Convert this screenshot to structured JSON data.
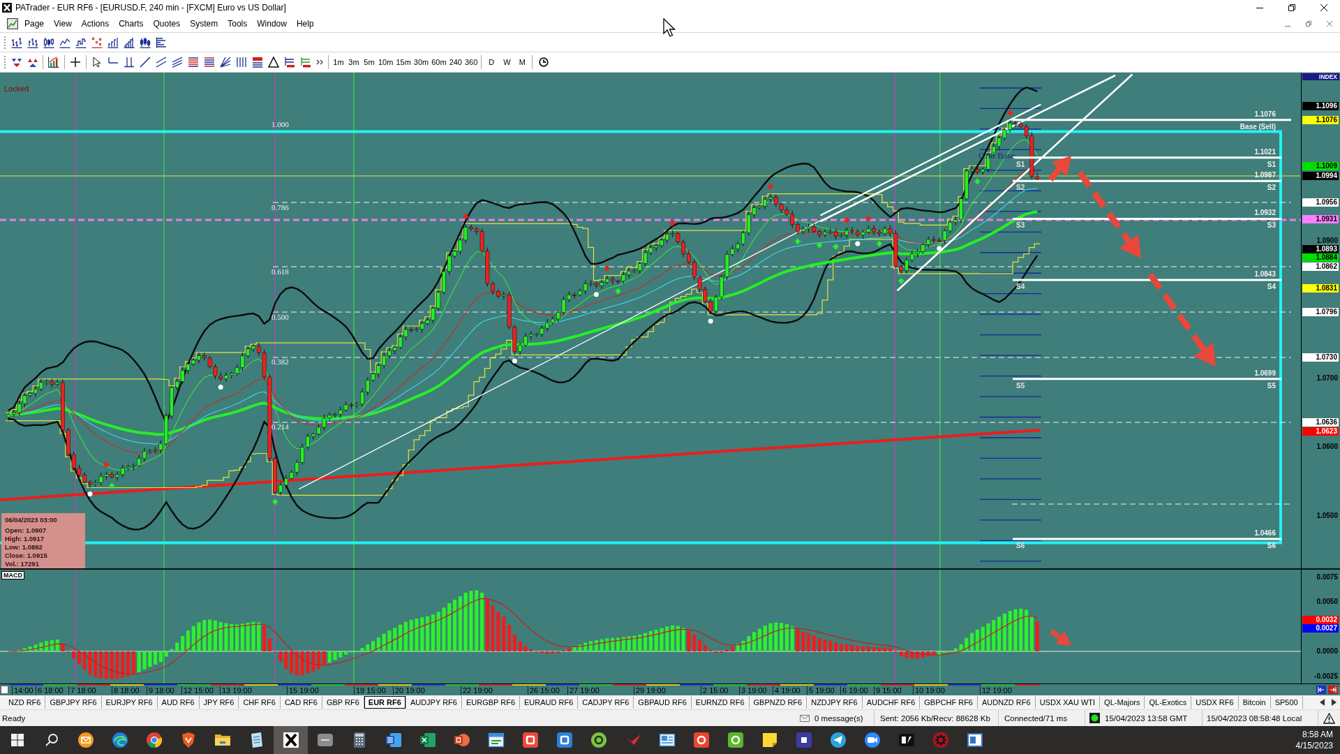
{
  "window": {
    "title": "PATrader - EUR RF6 - [EURUSD.F, 240 min - [FXCM] Euro vs US Dollar]"
  },
  "menu": [
    "Page",
    "View",
    "Actions",
    "Charts",
    "Quotes",
    "System",
    "Tools",
    "Window",
    "Help"
  ],
  "timeframes": [
    "1m",
    "3m",
    "5m",
    "10m",
    "15m",
    "30m",
    "60m",
    "240",
    "360"
  ],
  "periods": [
    "D",
    "W",
    "M"
  ],
  "chart": {
    "status": "Locked",
    "fib_levels": [
      "1.000",
      "0.786",
      "0.618",
      "0.500",
      "0.382",
      "0.214"
    ],
    "grid_label": "Grid Base",
    "pivots": [
      {
        "price": "1.1076",
        "label": "Base (Sell)"
      },
      {
        "price": "1.1021",
        "label": "S1",
        "start_label": "S1"
      },
      {
        "price": "1.0987",
        "label": "S2",
        "start_label": "S2"
      },
      {
        "price": "1.0932",
        "label": "S3",
        "start_label": "S3"
      },
      {
        "price": "1.0843",
        "label": "S4",
        "start_label": "S4"
      },
      {
        "price": "1.0699",
        "label": "S5",
        "start_label": "S5"
      },
      {
        "price": "1.0466",
        "label": "S6",
        "start_label": "S6"
      }
    ],
    "info": {
      "time": "06/04/2023 03:00",
      "lines": [
        "Open: 1.0907",
        "High: 1.0917",
        "Low: 1.0892",
        "Close: 1.0915",
        "Vol.: 17291"
      ]
    },
    "price_axis": {
      "header": "INDEX",
      "ticks": [
        "1.0900",
        "1.0700",
        "1.0600",
        "1.0500"
      ],
      "tags": [
        {
          "value": "1.1096",
          "color": "#000000"
        },
        {
          "value": "1.1076",
          "color": "#ffff00"
        },
        {
          "value": "1.1009",
          "color": "#00e000"
        },
        {
          "value": "1.0994",
          "color": "#000000"
        },
        {
          "value": "1.0956",
          "color": "#ffffff"
        },
        {
          "value": "1.0931",
          "color": "#ff80ff"
        },
        {
          "value": "1.0893",
          "color": "#000000"
        },
        {
          "value": "1.0884",
          "color": "#00e000"
        },
        {
          "value": "1.0862",
          "color": "#ffffff"
        },
        {
          "value": "1.0831",
          "color": "#ffff00"
        },
        {
          "value": "1.0796",
          "color": "#ffffff"
        },
        {
          "value": "1.0730",
          "color": "#ffffff"
        },
        {
          "value": "1.0636",
          "color": "#ffffff"
        },
        {
          "value": "1.0623",
          "color": "#ff0000"
        }
      ]
    }
  },
  "macd": {
    "label": "MACD",
    "axis": {
      "ticks": [
        "0.0075",
        "0.0050",
        "0.0000",
        "-0.0025"
      ],
      "tags": [
        {
          "value": "0.0032",
          "color": "#ff0000"
        },
        {
          "value": "0.0027",
          "color": "#0000ff"
        }
      ]
    }
  },
  "time_axis": [
    "14:00",
    "6 18:00",
    "7 18:00",
    "8 18:00",
    "9 18:00",
    "12 15:00",
    "13 19:00",
    "15 19:00",
    "19 15:00",
    "20 19:00",
    "22 19:00",
    "26 15:00",
    "27 19:00",
    "29 19:00",
    "2 15:00",
    "3 19:00",
    "4 19:00",
    "5 19:00",
    "6 19:00",
    "9 15:00",
    "10 19:00",
    "12 19:00"
  ],
  "tabs": [
    {
      "label": "NZD RF6",
      "selected": false
    },
    {
      "label": "GBPJPY RF6",
      "selected": false
    },
    {
      "label": "EURJPY RF6",
      "selected": false
    },
    {
      "label": "AUD RF6",
      "selected": false
    },
    {
      "label": "JPY RF6",
      "selected": false
    },
    {
      "label": "CHF RF6",
      "selected": false
    },
    {
      "label": "CAD RF6",
      "selected": false
    },
    {
      "label": "GBP RF6",
      "selected": false
    },
    {
      "label": "EUR RF6",
      "selected": true
    },
    {
      "label": "AUDJPY RF6",
      "selected": false
    },
    {
      "label": "EURGBP RF6",
      "selected": false
    },
    {
      "label": "EURAUD RF6",
      "selected": false
    },
    {
      "label": "CADJPY RF6",
      "selected": false
    },
    {
      "label": "GBPAUD RF6",
      "selected": false
    },
    {
      "label": "EURNZD RF6",
      "selected": false
    },
    {
      "label": "GBPNZD RF6",
      "selected": false
    },
    {
      "label": "NZDJPY RF6",
      "selected": false
    },
    {
      "label": "AUDCHF RF6",
      "selected": false
    },
    {
      "label": "GBPCHF RF6",
      "selected": false
    },
    {
      "label": "AUDNZD RF6",
      "selected": false
    },
    {
      "label": "USDX XAU WTI",
      "selected": false
    },
    {
      "label": "QL-Majors",
      "selected": false
    },
    {
      "label": "QL-Exotics",
      "selected": false
    },
    {
      "label": "USDX RF6",
      "selected": false
    },
    {
      "label": "Bitcoin",
      "selected": false
    },
    {
      "label": "SP500",
      "selected": false
    }
  ],
  "status_bar": {
    "text": "Ready",
    "messages": "0 message(s)",
    "traffic": "Sent: 2056 Kb/Recv: 88628 Kb",
    "connection": "Connected/71 ms",
    "connected": true,
    "server_time": "15/04/2023 13:58 GMT",
    "local_time": "15/04/2023 08:58:48 Local"
  },
  "taskbar": {
    "apps": [
      {
        "active": false
      },
      {
        "active": false
      },
      {
        "active": false
      },
      {
        "active": false
      },
      {
        "active": false
      },
      {
        "active": false
      },
      {
        "active": true
      },
      {
        "active": false
      },
      {
        "active": false
      },
      {
        "active": false
      },
      {
        "active": false
      },
      {
        "active": false
      },
      {
        "active": false
      },
      {
        "active": false
      },
      {
        "active": false
      },
      {
        "active": false
      },
      {
        "active": false
      },
      {
        "active": false
      },
      {
        "active": false
      },
      {
        "active": false
      },
      {
        "active": false
      },
      {
        "active": false
      },
      {
        "active": false
      },
      {
        "active": false
      },
      {
        "active": false
      },
      {
        "active": false
      },
      {
        "active": false
      }
    ],
    "time": "8:58 AM",
    "date": "4/15/2023"
  }
}
